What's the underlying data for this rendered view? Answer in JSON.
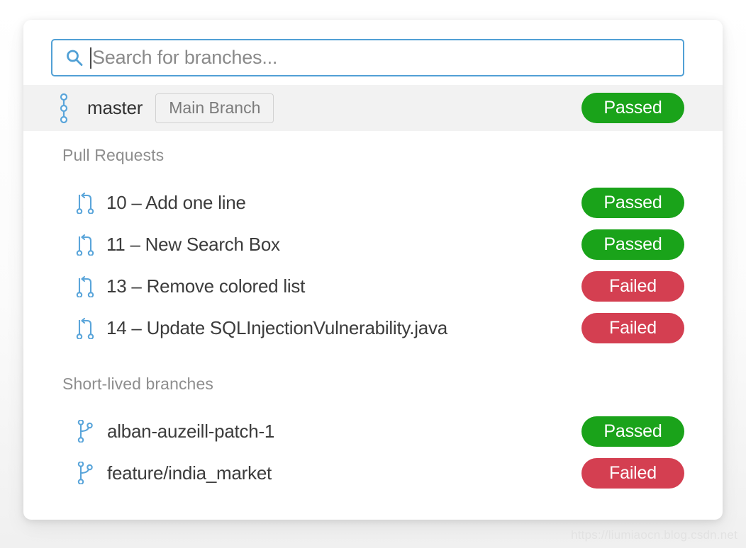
{
  "search": {
    "icon": "search-icon",
    "placeholder": "Search for branches...",
    "value": "",
    "border_color": "#51a0d5"
  },
  "main_branch": {
    "icon": "commit-chain-icon",
    "name": "master",
    "tag_label": "Main Branch",
    "status": "Passed"
  },
  "sections": [
    {
      "title": "Pull Requests",
      "item_icon": "pull-request-icon",
      "items": [
        {
          "label": "10 – Add one line",
          "status": "Passed"
        },
        {
          "label": "11 – New Search Box",
          "status": "Passed"
        },
        {
          "label": "13 – Remove colored list",
          "status": "Failed"
        },
        {
          "label": "14 – Update SQLInjectionVulnerability.java",
          "status": "Failed"
        }
      ]
    },
    {
      "title": "Short-lived branches",
      "item_icon": "branch-icon",
      "items": [
        {
          "label": "alban-auzeill-patch-1",
          "status": "Passed"
        },
        {
          "label": "feature/india_market",
          "status": "Failed"
        }
      ]
    }
  ],
  "colors": {
    "passed": "#1aa31a",
    "failed": "#d43f51",
    "accent_blue": "#51a0d5",
    "icon_blue": "#5aa5da",
    "row_highlight": "#f2f2f2"
  },
  "watermark": "https://liumiaocn.blog.csdn.net"
}
